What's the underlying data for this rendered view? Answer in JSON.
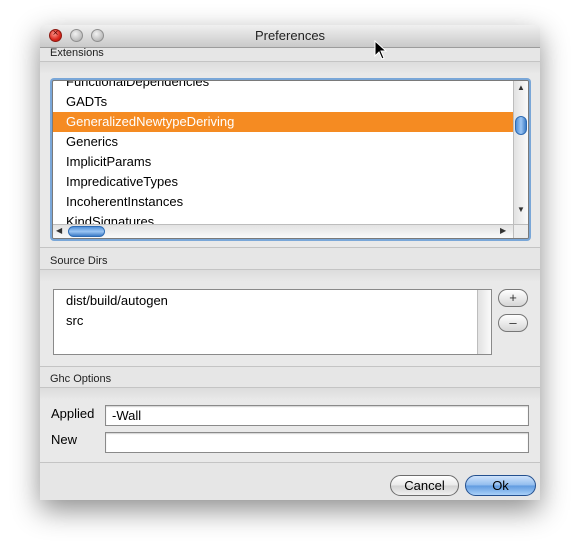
{
  "window": {
    "title": "Preferences"
  },
  "extensions": {
    "label": "Extensions",
    "items": [
      "FunctionalDependencies",
      "GADTs",
      "GeneralizedNewtypeDeriving",
      "Generics",
      "ImplicitParams",
      "ImpredicativeTypes",
      "IncoherentInstances",
      "KindSignatures"
    ],
    "selected": "GeneralizedNewtypeDeriving"
  },
  "source_dirs": {
    "label": "Source Dirs",
    "items": [
      "dist/build/autogen",
      "src"
    ],
    "add_label": "+",
    "remove_label": "–"
  },
  "ghc_options": {
    "label": "Ghc Options",
    "applied_label": "Applied",
    "applied_value": "-Wall",
    "new_label": "New",
    "new_value": ""
  },
  "buttons": {
    "cancel": "Cancel",
    "ok": "Ok"
  },
  "colors": {
    "selection": "#f58b22",
    "default_button": "#5f9ae0",
    "close_button": "#d9261c"
  },
  "icons": [
    "close-icon",
    "minimize-icon",
    "zoom-icon",
    "arrow-up-icon",
    "arrow-down-icon",
    "arrow-left-icon",
    "arrow-right-icon",
    "mouse-cursor-icon"
  ]
}
